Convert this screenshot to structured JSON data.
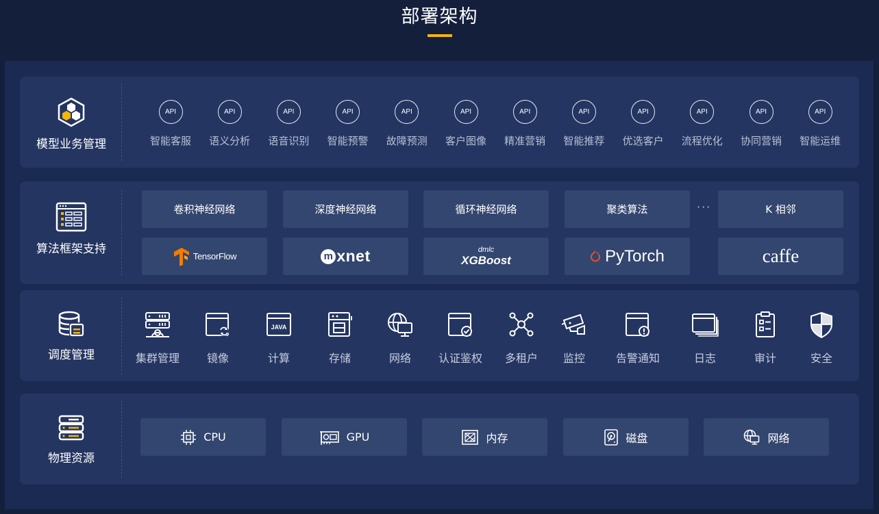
{
  "title": "部署架构",
  "colors": {
    "accent": "#f5b60b",
    "background": "#141f3b",
    "panel": "#243561",
    "box": "#33466f"
  },
  "model_layer": {
    "label": "模型业务管理",
    "icon": "hexagon-cluster-icon",
    "api_badge": "API",
    "items": [
      "智能客服",
      "语义分析",
      "语音识别",
      "智能预警",
      "故障预测",
      "客户图像",
      "精准营销",
      "智能推荐",
      "优选客户",
      "流程优化",
      "协同营销",
      "智能运维"
    ]
  },
  "algorithm_layer": {
    "label": "算法框架支持",
    "icon": "framework-grid-icon",
    "algorithms": [
      "卷积神经网络",
      "深度神经网络",
      "循环神经网络",
      "聚类算法",
      "K 相邻"
    ],
    "ellipsis": "···",
    "frameworks": {
      "tensorflow": "TensorFlow",
      "mxnet": "xnet",
      "xgboost_top": "dmlc",
      "xgboost": "XGBoost",
      "pytorch": "PyTorch",
      "caffe": "caffe"
    }
  },
  "scheduling_layer": {
    "label": "调度管理",
    "icon": "database-icon",
    "items": [
      {
        "label": "集群管理",
        "icon": "cluster-server-icon"
      },
      {
        "label": "镜像",
        "icon": "image-sync-icon"
      },
      {
        "label": "计算",
        "icon": "java-window-icon"
      },
      {
        "label": "存储",
        "icon": "storage-icon"
      },
      {
        "label": "网络",
        "icon": "network-globe-icon"
      },
      {
        "label": "认证鉴权",
        "icon": "auth-check-icon"
      },
      {
        "label": "多租户",
        "icon": "multi-tenant-icon"
      },
      {
        "label": "监控",
        "icon": "camera-icon"
      },
      {
        "label": "告警通知",
        "icon": "alert-window-icon"
      },
      {
        "label": "日志",
        "icon": "log-stack-icon"
      },
      {
        "label": "审计",
        "icon": "audit-clipboard-icon"
      },
      {
        "label": "安全",
        "icon": "shield-icon"
      }
    ]
  },
  "physical_layer": {
    "label": "物理资源",
    "icon": "server-stack-icon",
    "items": [
      {
        "label": "CPU",
        "icon": "cpu-icon"
      },
      {
        "label": "GPU",
        "icon": "gpu-icon"
      },
      {
        "label": "内存",
        "icon": "memory-icon"
      },
      {
        "label": "磁盘",
        "icon": "disk-icon"
      },
      {
        "label": "网络",
        "icon": "network-globe-icon"
      }
    ]
  }
}
